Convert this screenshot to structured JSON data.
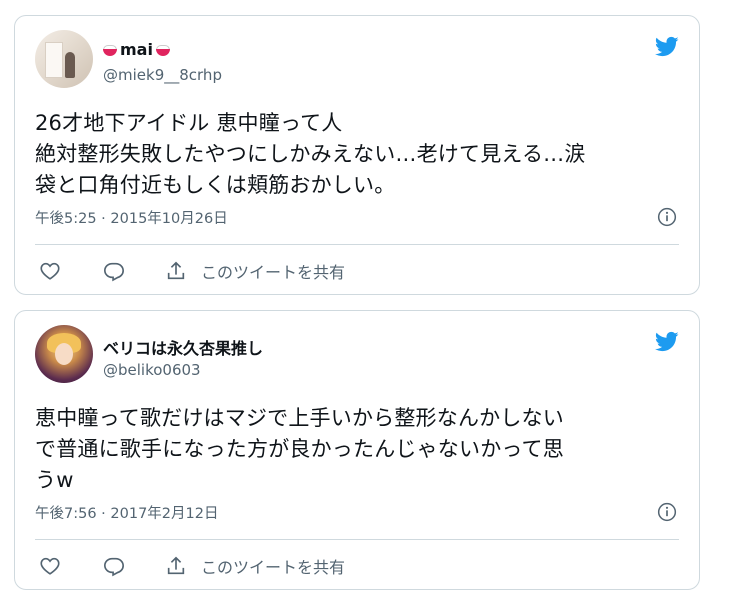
{
  "tweets": [
    {
      "display_name": "mai",
      "handle": "@miek9__8crhp",
      "text_lines": [
        "26才地下アイドル 恵中瞳って人",
        "絶対整形失敗したやつにしかみえない…老けて見える…涙",
        "袋と口角付近もしくは頬筋おかしい。"
      ],
      "timestamp": "午後5:25 · 2015年10月26日",
      "share_label": "このツイートを共有"
    },
    {
      "display_name": "ベリコは永久杏果推し",
      "handle": "@beliko0603",
      "text_lines": [
        "恵中瞳って歌だけはマジで上手いから整形なんかしない",
        "で普通に歌手になった方が良かったんじゃないかって思",
        "うw"
      ],
      "timestamp": "午後7:56 · 2017年2月12日",
      "share_label": "このツイートを共有"
    }
  ],
  "colors": {
    "twitter_blue": "#1d9bf0",
    "secondary_text": "#536471",
    "border": "#cfd9de"
  },
  "icons": [
    "twitter-bird-icon",
    "info-icon",
    "heart-icon",
    "reply-icon",
    "share-icon",
    "rice-bowl-emoji"
  ]
}
